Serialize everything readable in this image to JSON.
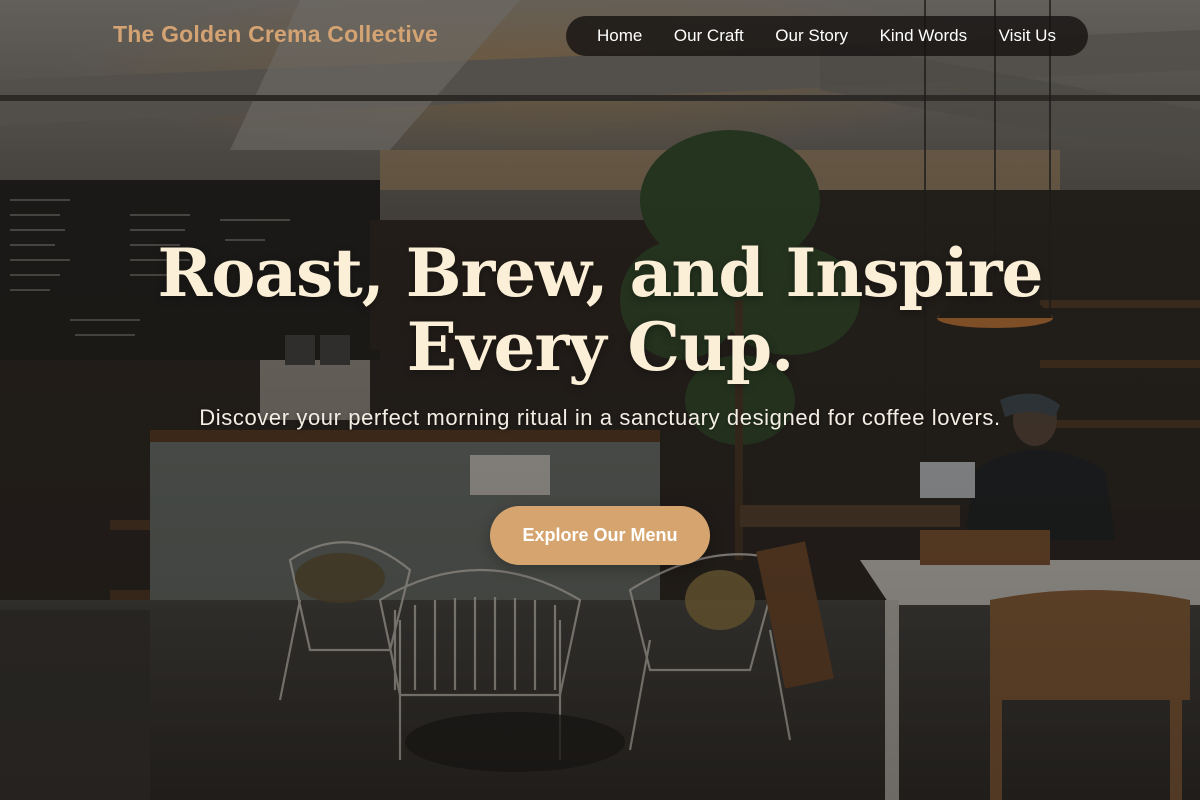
{
  "brand": {
    "name": "The Golden Crema Collective"
  },
  "nav": {
    "items": [
      {
        "label": "Home"
      },
      {
        "label": "Our Craft"
      },
      {
        "label": "Our Story"
      },
      {
        "label": "Kind Words"
      },
      {
        "label": "Visit Us"
      }
    ]
  },
  "hero": {
    "title": "Roast, Brew, and Inspire Every Cup.",
    "subtitle": "Discover your perfect morning ritual in a sanctuary designed for coffee lovers.",
    "cta_label": "Explore Our Menu"
  },
  "colors": {
    "brand_gold": "#d4a373",
    "title_cream": "#fbefd7",
    "cta_bg": "#d6a56f"
  },
  "background": {
    "description_icon": "cafe-interior-photo"
  }
}
